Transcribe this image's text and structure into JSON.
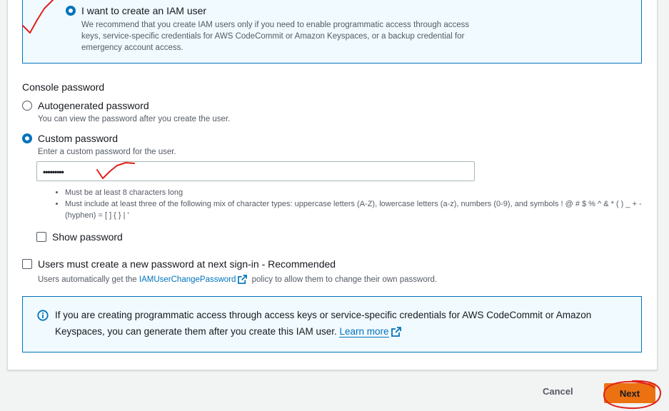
{
  "iam_option": {
    "label": "I want to create an IAM user",
    "description": "We recommend that you create IAM users only if you need to enable programmatic access through access keys, service-specific credentials for AWS CodeCommit or Amazon Keyspaces, or a backup credential for emergency account access."
  },
  "console_password": {
    "heading": "Console password",
    "autogenerated": {
      "label": "Autogenerated password",
      "description": "You can view the password after you create the user.",
      "selected": false
    },
    "custom": {
      "label": "Custom password",
      "description": "Enter a custom password for the user.",
      "selected": true,
      "value": "•••••••••"
    },
    "rules": [
      "Must be at least 8 characters long",
      "Must include at least three of the following mix of character types: uppercase letters (A-Z), lowercase letters (a-z), numbers (0-9), and symbols ! @ # $ % ^ & * ( ) _ + - (hyphen) = [ ] { } | '"
    ],
    "show_password_label": "Show password"
  },
  "reset_required": {
    "label": "Users must create a new password at next sign-in - Recommended",
    "desc_before": "Users automatically get the ",
    "policy_link": "IAMUserChangePassword",
    "desc_after": " policy to allow them to change their own password."
  },
  "info": {
    "text": "If you are creating programmatic access through access keys or service-specific credentials for AWS CodeCommit or Amazon Keyspaces, you can generate them after you create this IAM user. ",
    "link": "Learn more"
  },
  "footer": {
    "cancel_label": "Cancel",
    "next_label": "Next"
  },
  "colors": {
    "accent": "#0073bb",
    "primary_button": "#ec7211",
    "annotation": "#e0201a"
  }
}
